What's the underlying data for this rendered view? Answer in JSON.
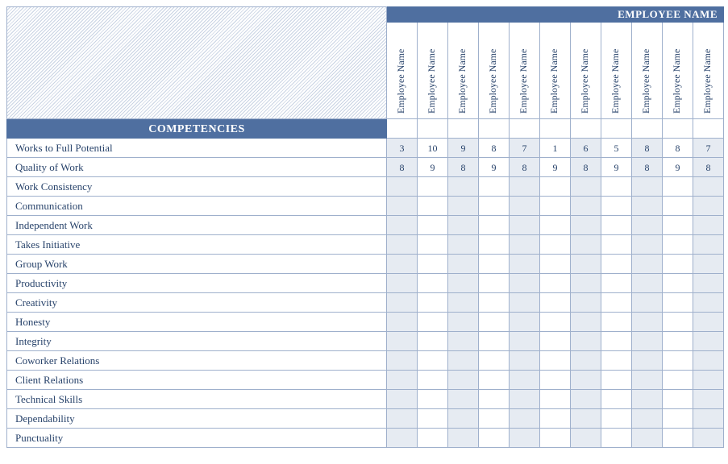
{
  "header": {
    "employee_name_title": "EMPLOYEE NAME",
    "competencies_title": "COMPETENCIES"
  },
  "employees": [
    "Employee Name",
    "Employee Name",
    "Employee Name",
    "Employee Name",
    "Employee Name",
    "Employee Name",
    "Employee Name",
    "Employee Name",
    "Employee Name",
    "Employee Name",
    "Employee Name"
  ],
  "competencies": [
    {
      "label": "Works to Full Potential",
      "values": [
        "3",
        "10",
        "9",
        "8",
        "7",
        "1",
        "6",
        "5",
        "8",
        "8",
        "7"
      ]
    },
    {
      "label": "Quality of Work",
      "values": [
        "8",
        "9",
        "8",
        "9",
        "8",
        "9",
        "8",
        "9",
        "8",
        "9",
        "8"
      ]
    },
    {
      "label": "Work Consistency",
      "values": [
        "",
        "",
        "",
        "",
        "",
        "",
        "",
        "",
        "",
        "",
        ""
      ]
    },
    {
      "label": "Communication",
      "values": [
        "",
        "",
        "",
        "",
        "",
        "",
        "",
        "",
        "",
        "",
        ""
      ]
    },
    {
      "label": "Independent Work",
      "values": [
        "",
        "",
        "",
        "",
        "",
        "",
        "",
        "",
        "",
        "",
        ""
      ]
    },
    {
      "label": "Takes Initiative",
      "values": [
        "",
        "",
        "",
        "",
        "",
        "",
        "",
        "",
        "",
        "",
        ""
      ]
    },
    {
      "label": "Group Work",
      "values": [
        "",
        "",
        "",
        "",
        "",
        "",
        "",
        "",
        "",
        "",
        ""
      ]
    },
    {
      "label": "Productivity",
      "values": [
        "",
        "",
        "",
        "",
        "",
        "",
        "",
        "",
        "",
        "",
        ""
      ]
    },
    {
      "label": "Creativity",
      "values": [
        "",
        "",
        "",
        "",
        "",
        "",
        "",
        "",
        "",
        "",
        ""
      ]
    },
    {
      "label": "Honesty",
      "values": [
        "",
        "",
        "",
        "",
        "",
        "",
        "",
        "",
        "",
        "",
        ""
      ]
    },
    {
      "label": "Integrity",
      "values": [
        "",
        "",
        "",
        "",
        "",
        "",
        "",
        "",
        "",
        "",
        ""
      ]
    },
    {
      "label": "Coworker Relations",
      "values": [
        "",
        "",
        "",
        "",
        "",
        "",
        "",
        "",
        "",
        "",
        ""
      ]
    },
    {
      "label": "Client Relations",
      "values": [
        "",
        "",
        "",
        "",
        "",
        "",
        "",
        "",
        "",
        "",
        ""
      ]
    },
    {
      "label": "Technical Skills",
      "values": [
        "",
        "",
        "",
        "",
        "",
        "",
        "",
        "",
        "",
        "",
        ""
      ]
    },
    {
      "label": "Dependability",
      "values": [
        "",
        "",
        "",
        "",
        "",
        "",
        "",
        "",
        "",
        "",
        ""
      ]
    },
    {
      "label": "Punctuality",
      "values": [
        "",
        "",
        "",
        "",
        "",
        "",
        "",
        "",
        "",
        "",
        ""
      ]
    }
  ]
}
